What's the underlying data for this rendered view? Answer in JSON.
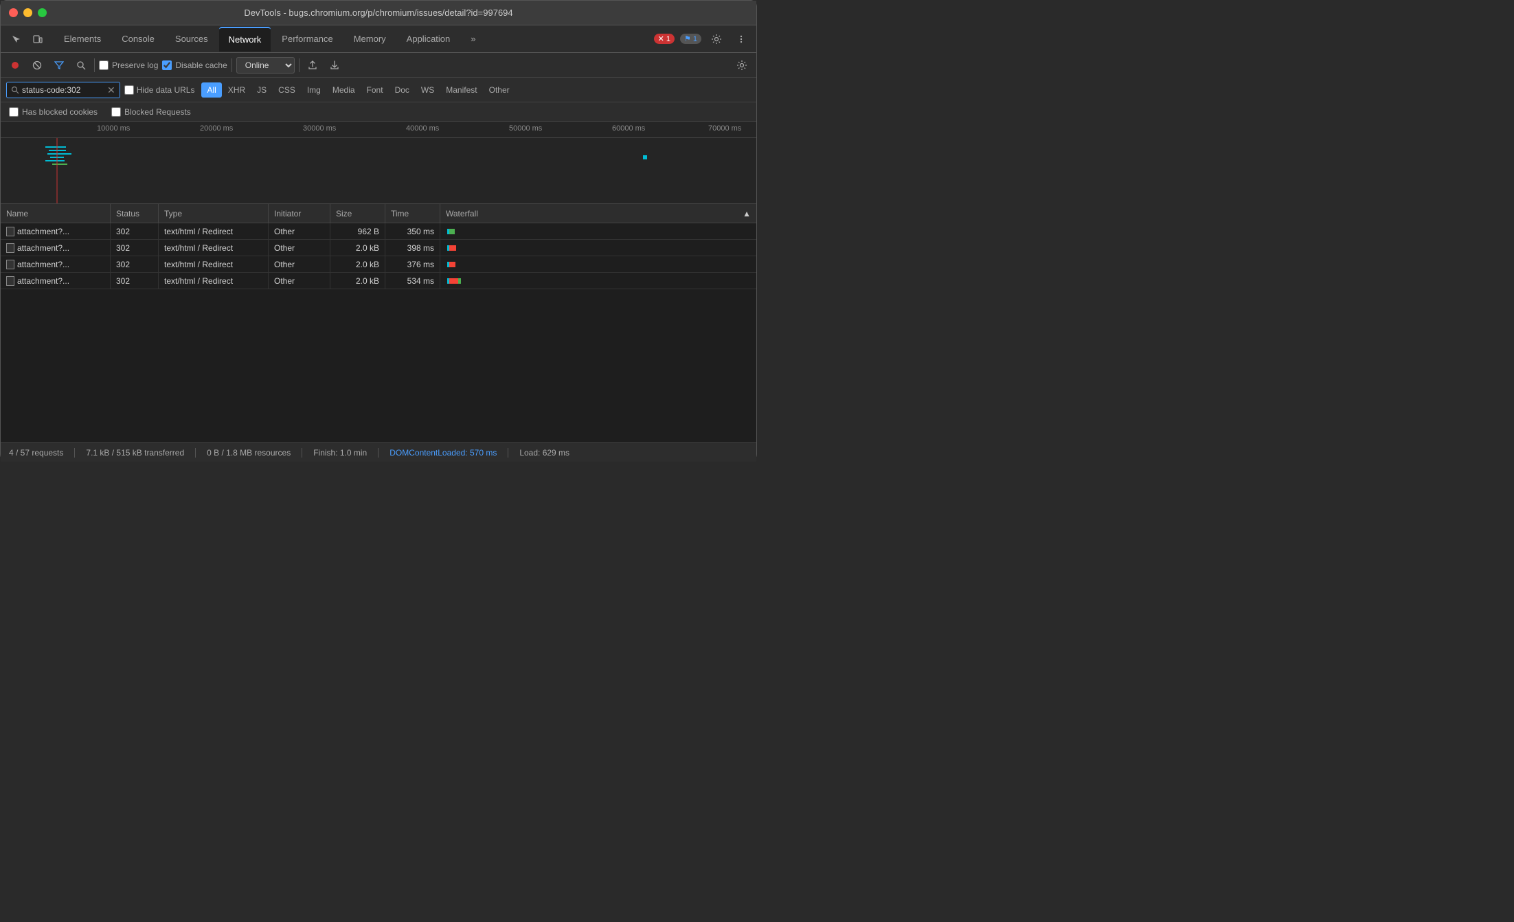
{
  "titlebar": {
    "title": "DevTools - bugs.chromium.org/p/chromium/issues/detail?id=997694"
  },
  "tabs": {
    "items": [
      {
        "label": "Elements",
        "active": false
      },
      {
        "label": "Console",
        "active": false
      },
      {
        "label": "Sources",
        "active": false
      },
      {
        "label": "Network",
        "active": true
      },
      {
        "label": "Performance",
        "active": false
      },
      {
        "label": "Memory",
        "active": false
      },
      {
        "label": "Application",
        "active": false
      }
    ],
    "more_label": "»",
    "error_count": "1",
    "warning_count": "1"
  },
  "toolbar": {
    "preserve_log_label": "Preserve log",
    "disable_cache_label": "Disable cache",
    "online_label": "Online"
  },
  "filter": {
    "value": "status-code:302",
    "hide_data_urls_label": "Hide data URLs",
    "all_label": "All",
    "types": [
      "XHR",
      "JS",
      "CSS",
      "Img",
      "Media",
      "Font",
      "Doc",
      "WS",
      "Manifest",
      "Other"
    ]
  },
  "checks": {
    "blocked_cookies_label": "Has blocked cookies",
    "blocked_requests_label": "Blocked Requests"
  },
  "timeline": {
    "ticks": [
      "10000 ms",
      "20000 ms",
      "30000 ms",
      "40000 ms",
      "50000 ms",
      "60000 ms",
      "70000 ms"
    ]
  },
  "table": {
    "headers": {
      "name": "Name",
      "status": "Status",
      "type": "Type",
      "initiator": "Initiator",
      "size": "Size",
      "time": "Time",
      "waterfall": "Waterfall"
    },
    "rows": [
      {
        "name": "attachment?...",
        "status": "302",
        "type": "text/html / Redirect",
        "initiator": "Other",
        "size": "962 B",
        "time": "350 ms"
      },
      {
        "name": "attachment?...",
        "status": "302",
        "type": "text/html / Redirect",
        "initiator": "Other",
        "size": "2.0 kB",
        "time": "398 ms"
      },
      {
        "name": "attachment?...",
        "status": "302",
        "type": "text/html / Redirect",
        "initiator": "Other",
        "size": "2.0 kB",
        "time": "376 ms"
      },
      {
        "name": "attachment?...",
        "status": "302",
        "type": "text/html / Redirect",
        "initiator": "Other",
        "size": "2.0 kB",
        "time": "534 ms"
      }
    ]
  },
  "statusbar": {
    "requests": "4 / 57 requests",
    "transferred": "7.1 kB / 515 kB transferred",
    "resources": "0 B / 1.8 MB resources",
    "finish": "Finish: 1.0 min",
    "dom_loaded": "DOMContentLoaded: 570 ms",
    "load": "Load: 629 ms"
  }
}
